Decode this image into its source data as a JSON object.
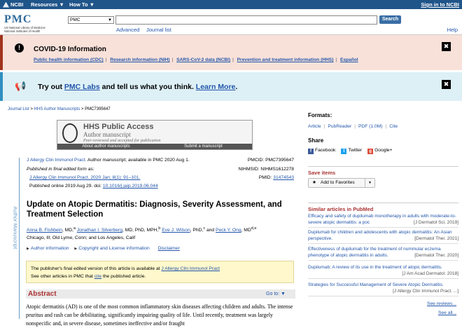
{
  "topbar": {
    "ncbi": "NCBI",
    "resources": "Resources ▼",
    "howto": "How To ▼",
    "signin": "Sign in to NCBI"
  },
  "header": {
    "logo": "PMC",
    "logo_sub1": "US National Library of Medicine",
    "logo_sub2": "National Institutes of Health",
    "db_select": "PMC",
    "search_placeholder": "",
    "search_button": "Search",
    "advanced": "Advanced",
    "journal_list": "Journal list",
    "help": "Help"
  },
  "covid": {
    "title": "COVID-19 Information",
    "links": [
      "Public health information (CDC)",
      "Research information (NIH)",
      "SARS-CoV-2 data (NCBI)",
      "Prevention and treatment information (HHS)",
      "Español"
    ],
    "close": "✖"
  },
  "labs": {
    "pre": "Try out ",
    "link1": "PMC Labs",
    "mid": " and tell us what you think. ",
    "link2": "Learn More",
    "post": ".",
    "close": "✖"
  },
  "breadcrumb": {
    "journal_list": "Journal List",
    "sep": " > ",
    "hhs": "HHS Author Manuscripts",
    "pmc": "PMC7395647"
  },
  "hhs_box": {
    "title": "HHS Public Access",
    "subtitle": "Author manuscript",
    "tagline": "Peer-reviewed and accepted for publication",
    "about": "About author manuscripts",
    "submit": "Submit a manuscript"
  },
  "vertical_label": "Author Manuscript",
  "meta": {
    "journal": "J Allergy Clin Immunol Pract.",
    "journal_rest": " Author manuscript; available in PMC 2020 Aug 1.",
    "final_label": "Published in final edited form as:",
    "citation": "J Allergy Clin Immunol Pract. 2020 Jan; 8(1): 91–101.",
    "online": "Published online 2019 Aug 29. doi: ",
    "doi": "10.1016/j.jaip.2019.06.044",
    "pmcid": "PMCID: PMC7395647",
    "nihmsid": "NIHMSID: NIHMS1612278",
    "pmid_label": "PMID: ",
    "pmid": "31474543"
  },
  "article": {
    "title": "Update on Atopic Dermatitis: Diagnosis, Severity Assessment, and Treatment Selection",
    "authors": [
      {
        "name": "Anna B. Fishbein",
        "suffix": ", MD,",
        "sup": "a"
      },
      {
        "name": "Jonathan I. Silverberg",
        "suffix": ", MD, PhD, MPH,",
        "sup": "b"
      },
      {
        "name": "Eve J. Wilson",
        "suffix": ", PhD,",
        "sup": "c"
      },
      {
        "name": "Peck Y. Ong",
        "suffix": ", MD",
        "sup": "d,e"
      }
    ],
    "and": " and ",
    "affil": "Chicago, Ill; Old Lyme, Conn; and Los Angeles, Calif",
    "author_info": "Author information",
    "copyright_info": "Copyright and License information",
    "disclaimer": "Disclaimer",
    "notice_line1": "The publisher's final edited version of this article is available at ",
    "notice_link": "J Allergy Clin Immunol Pract",
    "notice_line2a": "See other articles in PMC that ",
    "notice_cite": "cite",
    "notice_line2b": " the published article.",
    "abstract_heading": "Abstract",
    "goto": "Go to: ▼",
    "abstract_text": "Atopic dermatitis (AD) is one of the most common inflammatory skin diseases affecting children and adults. The intense pruritus and rash can be debilitating, significantly impairing quality of life. Until recently, treatment was largely nonspecific and, in severe disease, sometimes ineffective and/or fraught"
  },
  "sidebar": {
    "formats_heading": "Formats:",
    "formats": [
      "Article",
      "PubReader",
      "PDF (1.0M)",
      "Cite"
    ],
    "share_heading": "Share",
    "share": [
      "Facebook",
      "Twitter",
      "Google+"
    ],
    "save_heading": "Save items",
    "add_favorites": "Add to Favorites",
    "similar_heading": "Similar articles in PubMed",
    "similar": [
      {
        "title": "Efficacy and safety of dupilumab monotherapy in adults with moderate-to-severe atopic dermatitis: a poc",
        "source": "[J Dermatol Sci. 2019]"
      },
      {
        "title": "Dupilumab for children and adolescents with atopic dermatitis: An Asian perspective.",
        "source": "[Dermatol Ther. 2021]"
      },
      {
        "title": "Effectiveness of dupilumab for the treatment of nummular eczema phenotype of atopic dermatitis in adults.",
        "source": "[Dermatol Ther. 2020]"
      },
      {
        "title": "Dupilumab: A review of its use in the treatment of atopic dermatitis.",
        "source": "[J Am Acad Dermatol. 2018]"
      },
      {
        "title": "Strategies for Successful Management of Severe Atopic Dermatitis.",
        "source": "[J Allergy Clin Immunol Pract. ...]"
      }
    ],
    "see_reviews": "See reviews...",
    "see_all": "See all..."
  }
}
